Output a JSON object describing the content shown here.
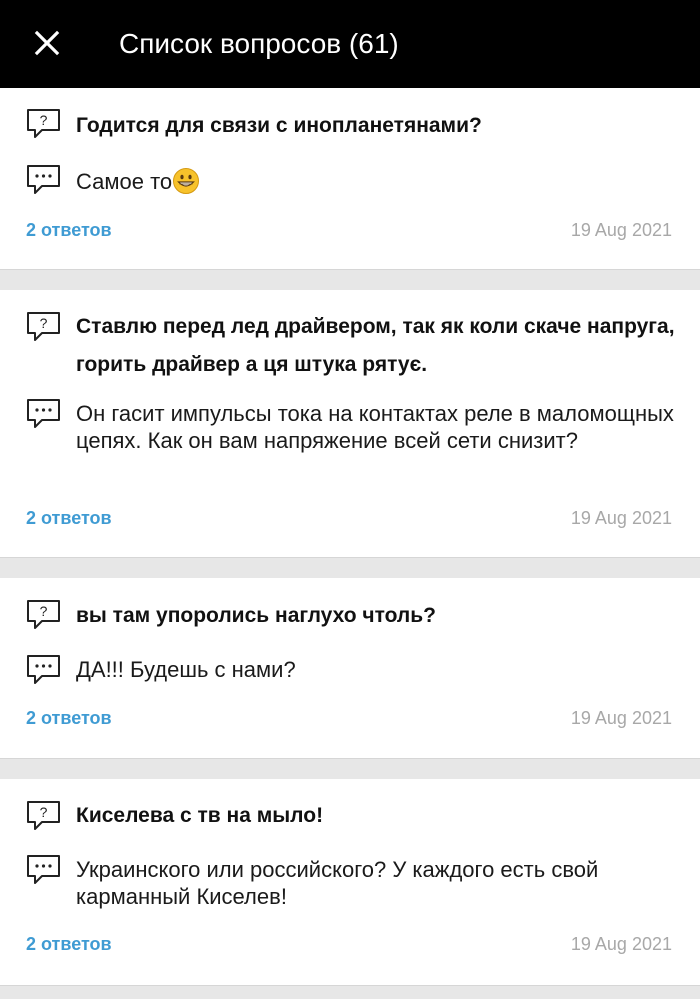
{
  "header": {
    "title": "Список вопросов (61)",
    "close_icon": "close-icon"
  },
  "colors": {
    "header_bg": "#000000",
    "link": "#3f9bd3",
    "date": "#a8a8a8",
    "background": "#e7e7e7"
  },
  "questions": [
    {
      "question": "Годится для связи с инопланетянами?",
      "answer": "Самое то",
      "answer_emoji": "grinning-face-emoji",
      "answers_link": "2 ответов",
      "date": "19 Aug 2021"
    },
    {
      "question": "Ставлю перед лед драйвером, так як коли скаче напруга, горить драйвер а ця штука рятує.",
      "answer": "Он гасит импульсы тока на контактах реле в маломощных цепях. Как он вам напряжение всей сети снизит?",
      "answers_link": "2 ответов",
      "date": "19 Aug 2021"
    },
    {
      "question": "вы там упоролись наглухо чтоль?",
      "answer": "ДА!!! Будешь с нами?",
      "answers_link": "2 ответов",
      "date": "19 Aug 2021"
    },
    {
      "question": "Киселева с тв на мыло!",
      "answer": "Украинского или российского? У каждого есть свой карманный Киселев!",
      "answers_link": "2 ответов",
      "date": "19 Aug 2021"
    }
  ]
}
